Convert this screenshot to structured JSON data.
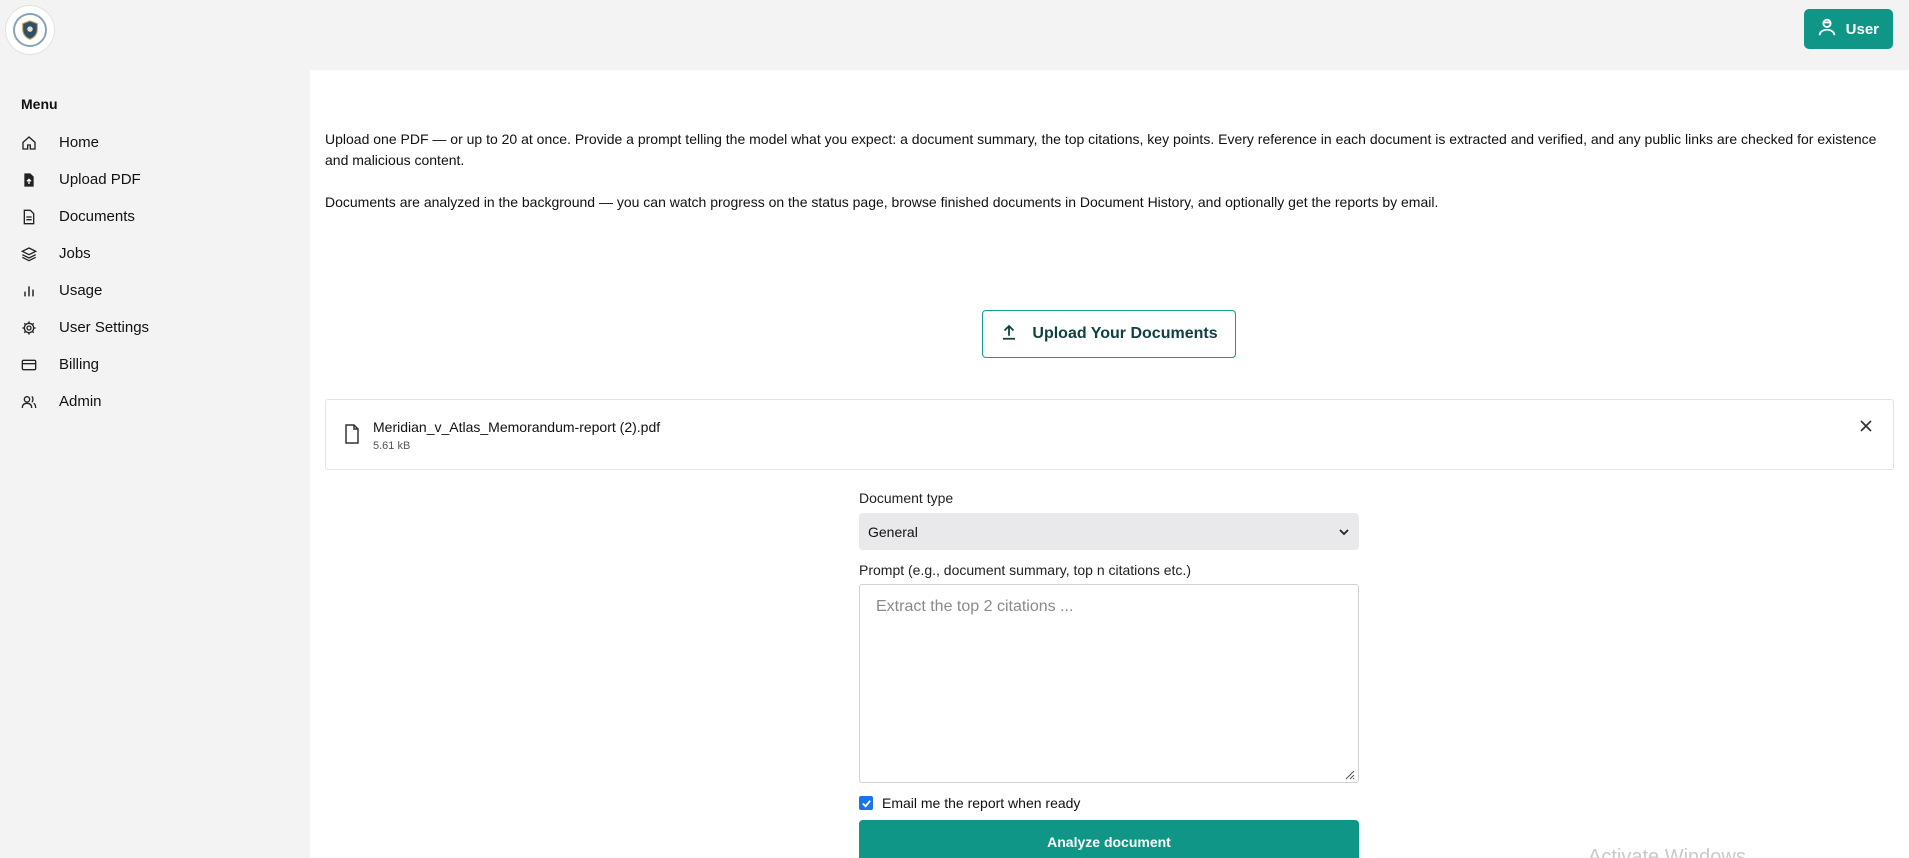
{
  "header": {
    "logo_icon": "shield-emblem-icon",
    "user_button_label": "User"
  },
  "sidebar": {
    "menu_title": "Menu",
    "items": [
      {
        "label": "Home",
        "icon": "home-icon"
      },
      {
        "label": "Upload PDF",
        "icon": "file-upload-icon"
      },
      {
        "label": "Documents",
        "icon": "document-icon"
      },
      {
        "label": "Jobs",
        "icon": "layers-icon"
      },
      {
        "label": "Usage",
        "icon": "bar-chart-icon"
      },
      {
        "label": "User Settings",
        "icon": "gear-icon"
      },
      {
        "label": "Billing",
        "icon": "credit-card-icon"
      },
      {
        "label": "Admin",
        "icon": "users-icon"
      }
    ]
  },
  "main": {
    "intro_1": "Upload one PDF — or up to 20 at once. Provide a prompt telling the model what you expect: a document summary, the top citations, key points. Every reference in each document is extracted and verified, and any public links are checked for existence and malicious content.",
    "intro_2": "Documents are analyzed in the background — you can watch progress on the status page, browse finished documents in Document History, and optionally get the reports by email.",
    "upload_button_label": "Upload Your Documents",
    "file": {
      "name": "Meridian_v_Atlas_Memorandum-report (2).pdf",
      "size": "5.61 kB"
    },
    "form": {
      "document_type_label": "Document type",
      "document_type_value": "General",
      "prompt_label": "Prompt (e.g., document summary, top n citations etc.)",
      "prompt_placeholder": "Extract the top 2 citations ...",
      "email_label": "Email me the report when ready",
      "email_checked": true,
      "analyze_label": "Analyze document"
    }
  },
  "watermark": "Activate Windows",
  "colors": {
    "accent": "#0f9686",
    "sidebar_bg": "#f3f3f3",
    "checkbox": "#1a73e8"
  }
}
